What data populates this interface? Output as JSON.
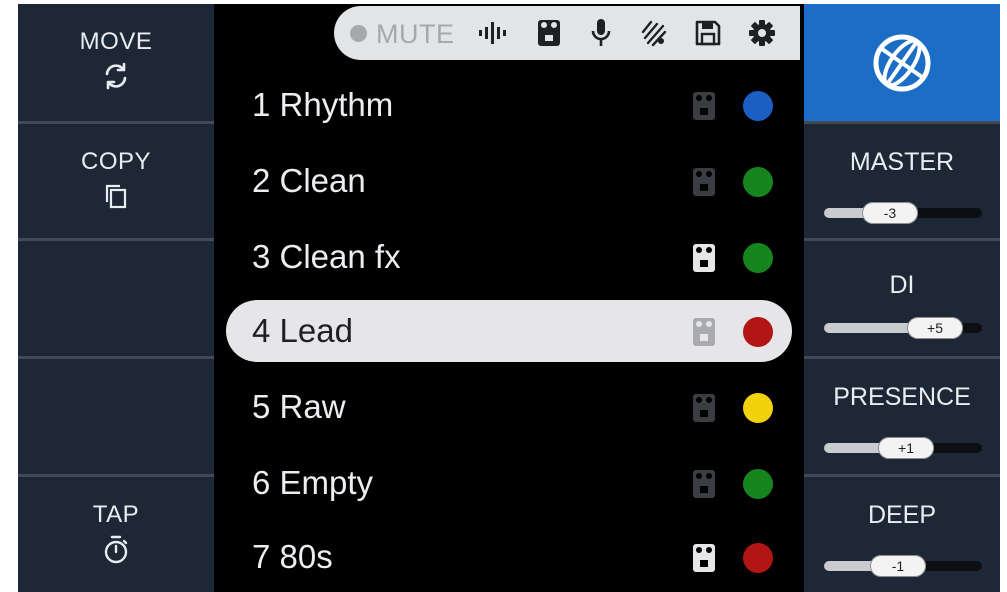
{
  "left": {
    "move_label": "MOVE",
    "copy_label": "COPY",
    "tap_label": "TAP"
  },
  "toolbar": {
    "mute_label": "MUTE",
    "icons": [
      "record-dot-icon",
      "tuner-icon",
      "pedal-icon",
      "microphone-icon",
      "bluetooth-audio-icon",
      "save-icon",
      "gear-icon"
    ]
  },
  "presets": [
    {
      "name": "1 Rhythm",
      "color": "#1b5fc4",
      "pedal_active": false,
      "selected": false
    },
    {
      "name": "2 Clean",
      "color": "#16851e",
      "pedal_active": false,
      "selected": false
    },
    {
      "name": "3 Clean fx",
      "color": "#16851e",
      "pedal_active": true,
      "selected": false
    },
    {
      "name": "4 Lead",
      "color": "#b31414",
      "pedal_active": true,
      "selected": true
    },
    {
      "name": "5 Raw",
      "color": "#f2d20c",
      "pedal_active": false,
      "selected": false
    },
    {
      "name": "6 Empty",
      "color": "#16851e",
      "pedal_active": false,
      "selected": false
    },
    {
      "name": "7 80s",
      "color": "#b31414",
      "pedal_active": true,
      "selected": false
    }
  ],
  "knobs": [
    {
      "label": "MASTER",
      "value_text": "-3",
      "level": 0.42
    },
    {
      "label": "DI",
      "value_text": "+5",
      "level": 0.7
    },
    {
      "label": "PRESENCE",
      "value_text": "+1",
      "level": 0.52
    },
    {
      "label": "DEEP",
      "value_text": "-1",
      "level": 0.47
    }
  ],
  "colors": {
    "panel": "#1e2735",
    "accent_blue": "#1c6dc6",
    "selected_row": "#e6e6e8"
  }
}
